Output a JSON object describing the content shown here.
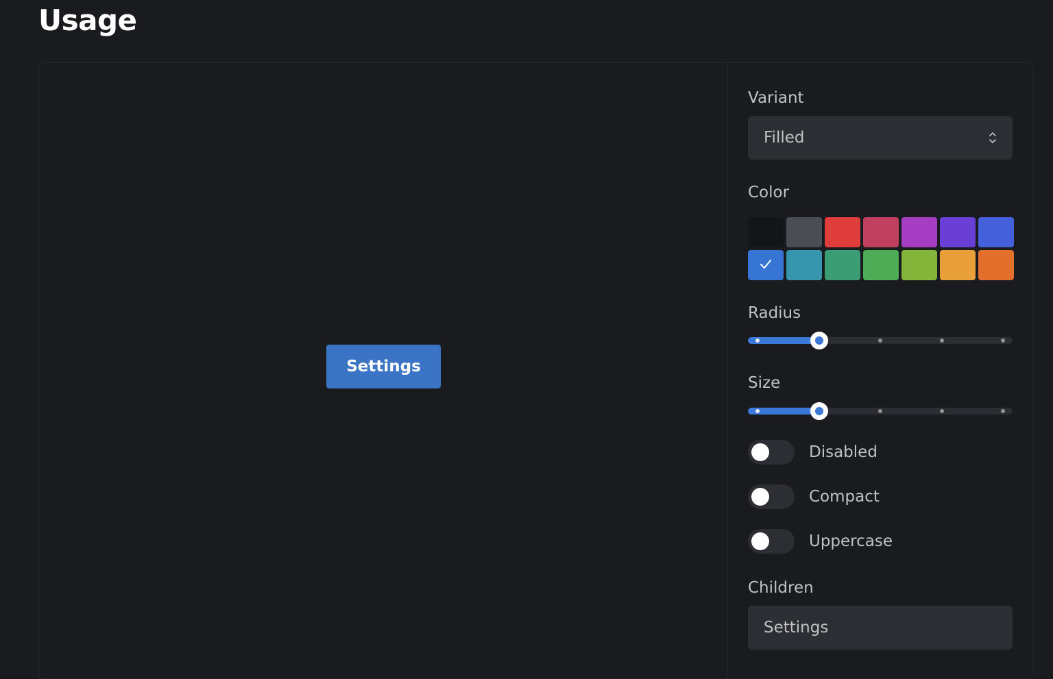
{
  "page": {
    "title": "Usage"
  },
  "preview": {
    "button_label": "Settings",
    "button_color": "#3b74c4"
  },
  "controls": {
    "variant": {
      "label": "Variant",
      "value": "Filled",
      "icon": "chevron-up-down-icon"
    },
    "color": {
      "label": "Color",
      "selected": "blue",
      "swatches": [
        {
          "name": "dark",
          "hex": "#141517"
        },
        {
          "name": "gray",
          "hex": "#4a4d53"
        },
        {
          "name": "red",
          "hex": "#e03d3d"
        },
        {
          "name": "pink",
          "hex": "#c2405f"
        },
        {
          "name": "grape",
          "hex": "#a53ec2"
        },
        {
          "name": "violet",
          "hex": "#6a3fd6"
        },
        {
          "name": "indigo",
          "hex": "#4461db"
        },
        {
          "name": "blue",
          "hex": "#3675d4"
        },
        {
          "name": "cyan",
          "hex": "#3796ad"
        },
        {
          "name": "teal",
          "hex": "#3a9d73"
        },
        {
          "name": "green",
          "hex": "#4eac56"
        },
        {
          "name": "lime",
          "hex": "#84b53a"
        },
        {
          "name": "yellow",
          "hex": "#e9a03a"
        },
        {
          "name": "orange",
          "hex": "#e26f2c"
        }
      ]
    },
    "radius": {
      "label": "Radius",
      "steps": 5,
      "value_index": 1
    },
    "size": {
      "label": "Size",
      "steps": 5,
      "value_index": 1
    },
    "switches": [
      {
        "key": "disabled",
        "label": "Disabled",
        "checked": false
      },
      {
        "key": "compact",
        "label": "Compact",
        "checked": false
      },
      {
        "key": "uppercase",
        "label": "Uppercase",
        "checked": false
      }
    ],
    "children": {
      "label": "Children",
      "value": "Settings"
    }
  },
  "colors": {
    "accent": "#3b78d8",
    "surface": "#2c2e33",
    "background": "#1a1b1e"
  }
}
